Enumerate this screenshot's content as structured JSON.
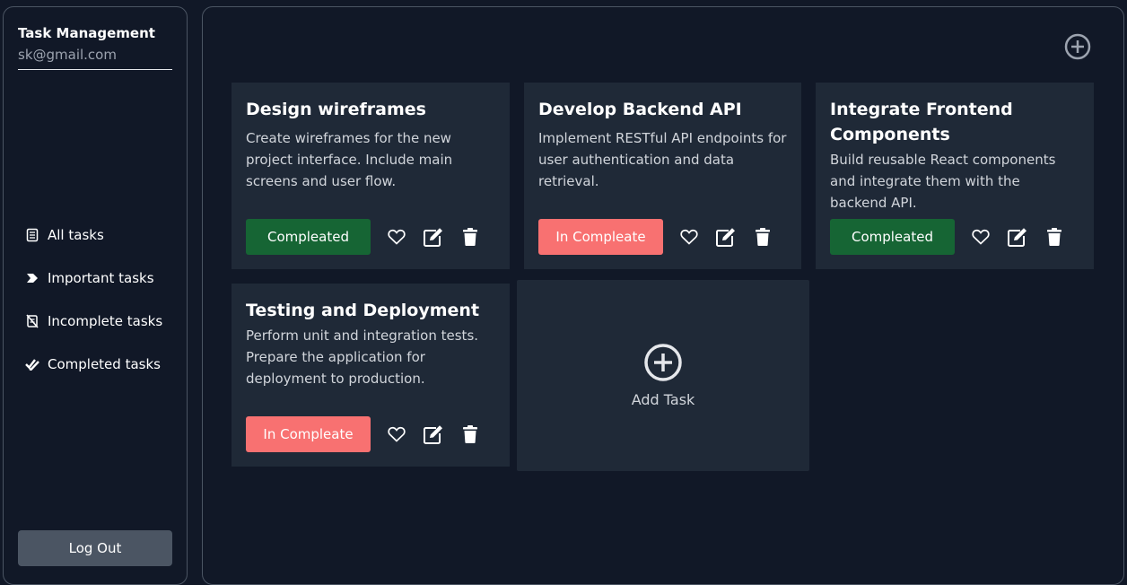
{
  "sidebar": {
    "name": "Task Management",
    "email": "sk@gmail.com",
    "nav": [
      {
        "label": "All tasks",
        "icon": "clipboard-list-icon"
      },
      {
        "label": "Important tasks",
        "icon": "arrow-tag-icon"
      },
      {
        "label": "Incomplete tasks",
        "icon": "clipboard-slash-icon"
      },
      {
        "label": "Completed tasks",
        "icon": "double-check-icon"
      }
    ],
    "logout_label": "Log Out"
  },
  "tasks": [
    {
      "title": "Design wireframes",
      "description": "Create wireframes for the new project interface. Include main screens and user flow.",
      "status": "Compleated"
    },
    {
      "title": "Develop Backend API",
      "description": "Implement RESTful API endpoints for user authentication and data retrieval.",
      "status": "In Compleate"
    },
    {
      "title": "Integrate Frontend Components",
      "description": "Build reusable React components and integrate them with the backend API.",
      "status": "Compleated"
    },
    {
      "title": "Testing and Deployment",
      "description": "Perform unit and integration tests. Prepare the application for deployment to production.",
      "status": "In Compleate"
    }
  ],
  "add_task_label": "Add Task",
  "colors": {
    "background": "#111827",
    "card": "#1f2937",
    "complete": "#166534",
    "incomplete": "#f87171",
    "logout": "#4b5563"
  }
}
